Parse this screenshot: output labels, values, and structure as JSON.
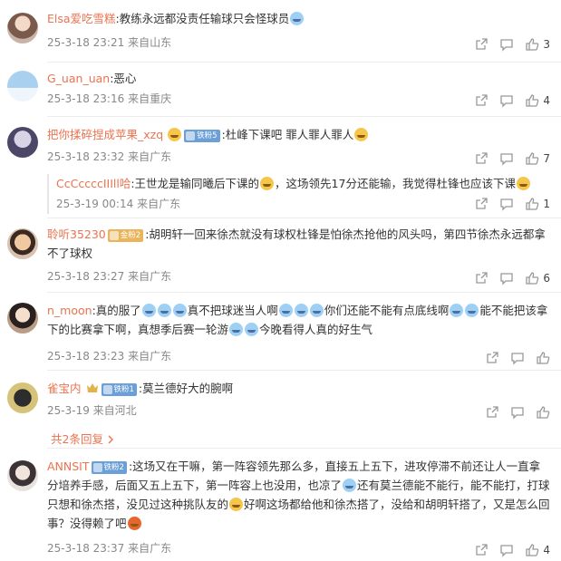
{
  "comments": [
    {
      "username": "Elsa爱吃雪糕",
      "text": ":教练永远都没责任输球只会怪球员",
      "time": "25-3-18 23:21",
      "location": "来自山东",
      "likes": "3"
    },
    {
      "username": "G_uan_uan",
      "text": ":恶心",
      "time": "25-3-18 23:16",
      "location": "来自重庆",
      "likes": "4"
    },
    {
      "username": "把你揉碎捏成苹果_xzq",
      "badge": "铁粉5",
      "text": ":杜峰下课吧 罪人罪人罪人",
      "time": "25-3-18 23:32",
      "location": "来自广东",
      "likes": "7",
      "reply": {
        "username": "CcCccccIIIll哈",
        "text": ":王世龙是输同曦后下课的",
        "text2": "，这场领先17分还能输，我觉得杜锋也应该下课",
        "time": "25-3-19 00:14",
        "location": "来自广东",
        "likes": "1"
      }
    },
    {
      "username": "聆听35230",
      "badge": "金粉2",
      "text": ":胡明轩一回来徐杰就没有球权杜锋是怕徐杰抢他的风头吗，第四节徐杰永远都拿不了球权",
      "time": "25-3-18 23:27",
      "location": "来自广东",
      "likes": "6"
    },
    {
      "username": "n_moon",
      "text_a": ":真的服了",
      "text_b": "真不把球迷当人啊",
      "text_c": "你们还能不能有点底线啊",
      "text_d": "能不能把该拿下的比赛拿下啊，真想季后赛一轮游",
      "text_e": "今晚看得人真的好生气",
      "time": "25-3-18 23:23",
      "location": "来自广东",
      "likes": ""
    },
    {
      "username": "雀宝内",
      "badge": "铁粉1",
      "text": ":莫兰德好大的腕啊",
      "time": "25-3-19",
      "location": "来自河北",
      "likes": "",
      "more_replies": "共2条回复"
    },
    {
      "username": "ANNSIT",
      "badge": "铁粉2",
      "text_a": ":这场又在干嘛，第一阵容领先那么多，直接五上五下，进攻停滞不前还让人一直拿分培养手感，后面又五上五下，第一阵容上也没用，也凉了",
      "text_b": "还有莫兰德能不能行，能不能打，打球只想和徐杰搭，没见过这种挑队友的",
      "text_c": "好啊这场都给他和徐杰搭了，没给和胡明轩搭了，又是怎么回事？没得赖了吧",
      "time": "25-3-18 23:37",
      "location": "来自广东",
      "likes": "4"
    }
  ],
  "colors": {
    "username": "#eb7350",
    "reply_username": "#3680c8",
    "meta": "#888888"
  },
  "icons": [
    "share-icon",
    "comment-icon",
    "like-icon",
    "crown-icon",
    "emoji-icon"
  ]
}
